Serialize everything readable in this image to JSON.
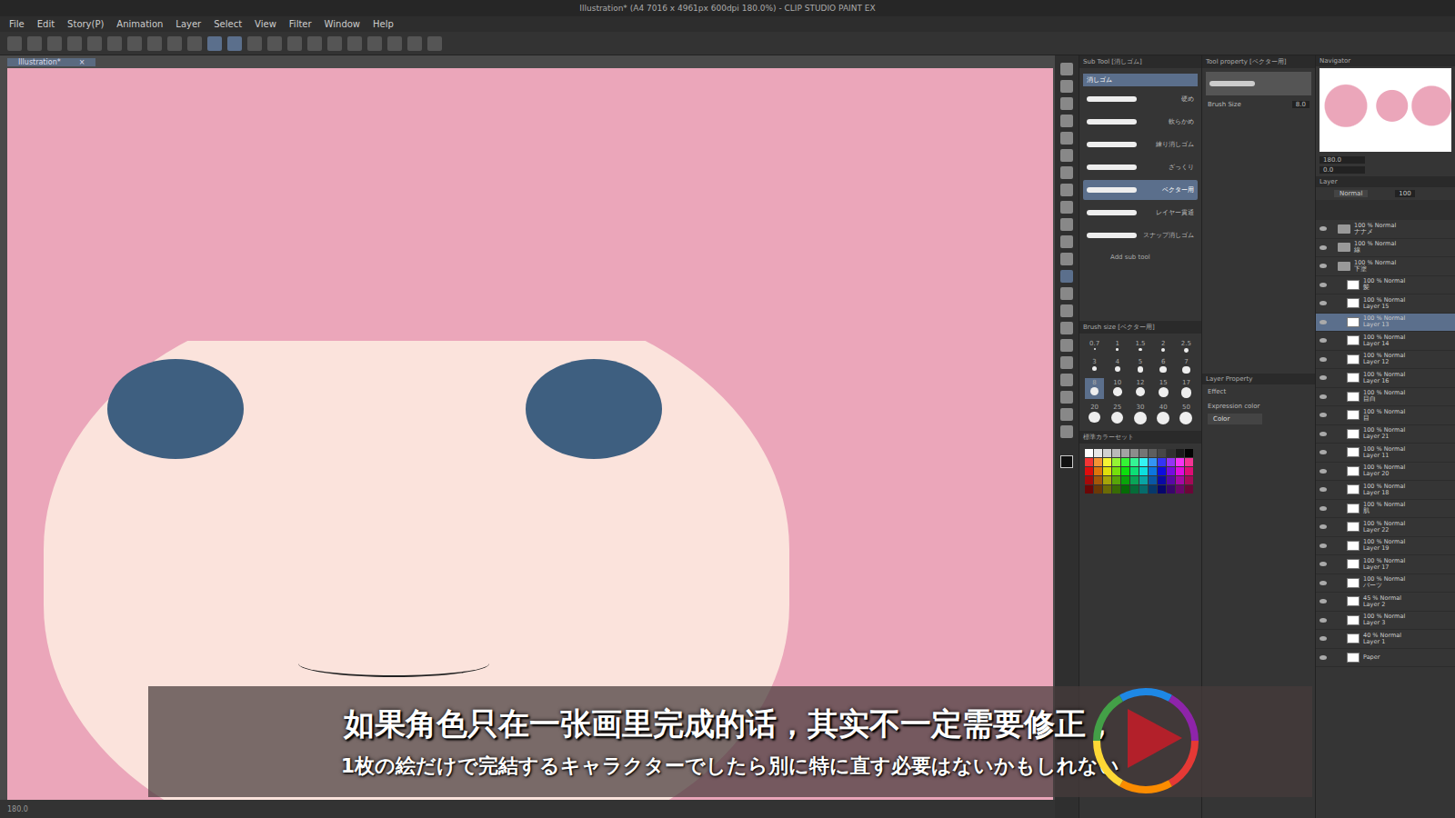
{
  "window": {
    "title": "Illustration* (A4 7016 x 4961px 600dpi 180.0%) - CLIP STUDIO PAINT EX"
  },
  "menu": [
    "File",
    "Edit",
    "Story(P)",
    "Animation",
    "Layer",
    "Select",
    "View",
    "Filter",
    "Window",
    "Help"
  ],
  "canvas_tab": {
    "label": "Illustration*",
    "close": "×"
  },
  "sub_tool": {
    "title": "Sub Tool [消しゴム]",
    "group": "消しゴム",
    "items": [
      {
        "label": "硬め",
        "selected": false
      },
      {
        "label": "軟らかめ",
        "selected": false
      },
      {
        "label": "練り消しゴム",
        "selected": false
      },
      {
        "label": "ざっくり",
        "selected": false
      },
      {
        "label": "ベクター用",
        "selected": true
      },
      {
        "label": "レイヤー貫通",
        "selected": false
      },
      {
        "label": "スナップ消しゴム",
        "selected": false
      }
    ],
    "add": "Add sub tool"
  },
  "tool_property": {
    "title": "Tool property [ベクター用]",
    "brush_size_label": "Brush Size",
    "brush_size": "8.0"
  },
  "brush_size_panel": {
    "title": "Brush size [ベクター用]",
    "sizes": [
      {
        "value": "0.7",
        "selected": false
      },
      {
        "value": "1",
        "selected": false
      },
      {
        "value": "1.5",
        "selected": false
      },
      {
        "value": "2",
        "selected": false
      },
      {
        "value": "2.5",
        "selected": false
      },
      {
        "value": "3",
        "selected": false
      },
      {
        "value": "4",
        "selected": false
      },
      {
        "value": "5",
        "selected": false
      },
      {
        "value": "6",
        "selected": false
      },
      {
        "value": "7",
        "selected": false
      },
      {
        "value": "8",
        "selected": true
      },
      {
        "value": "10",
        "selected": false
      },
      {
        "value": "12",
        "selected": false
      },
      {
        "value": "15",
        "selected": false
      },
      {
        "value": "17",
        "selected": false
      },
      {
        "value": "20",
        "selected": false
      },
      {
        "value": "25",
        "selected": false
      },
      {
        "value": "30",
        "selected": false
      },
      {
        "value": "40",
        "selected": false
      },
      {
        "value": "50",
        "selected": false
      }
    ]
  },
  "color_set": {
    "title": "標準カラーセット"
  },
  "navigator": {
    "title": "Navigator",
    "zoom": "180.0",
    "angle": "0.0"
  },
  "layer_property": {
    "title": "Layer Property",
    "effect": "Effect",
    "expression_label": "Expression color",
    "expression": "Color"
  },
  "layer": {
    "title": "Layer",
    "blend": "Normal",
    "opacity": "100",
    "layers": [
      {
        "mode": "100 % Normal",
        "name": "ナナメ",
        "kind": "folder",
        "selected": false
      },
      {
        "mode": "100 % Normal",
        "name": "線",
        "kind": "folder",
        "selected": false
      },
      {
        "mode": "100 % Normal",
        "name": "下塗",
        "kind": "folder",
        "selected": false
      },
      {
        "mode": "100 % Normal",
        "name": "髪",
        "kind": "layer",
        "selected": false
      },
      {
        "mode": "100 % Normal",
        "name": "Layer 15",
        "kind": "layer",
        "selected": false
      },
      {
        "mode": "100 % Normal",
        "name": "Layer 13",
        "kind": "layer",
        "selected": true
      },
      {
        "mode": "100 % Normal",
        "name": "Layer 14",
        "kind": "layer",
        "selected": false
      },
      {
        "mode": "100 % Normal",
        "name": "Layer 12",
        "kind": "layer",
        "selected": false
      },
      {
        "mode": "100 % Normal",
        "name": "Layer 16",
        "kind": "layer",
        "selected": false
      },
      {
        "mode": "100 % Normal",
        "name": "目白",
        "kind": "layer",
        "selected": false
      },
      {
        "mode": "100 % Normal",
        "name": "目",
        "kind": "layer",
        "selected": false
      },
      {
        "mode": "100 % Normal",
        "name": "Layer 21",
        "kind": "layer",
        "selected": false
      },
      {
        "mode": "100 % Normal",
        "name": "Layer 11",
        "kind": "layer",
        "selected": false
      },
      {
        "mode": "100 % Normal",
        "name": "Layer 20",
        "kind": "layer",
        "selected": false
      },
      {
        "mode": "100 % Normal",
        "name": "Layer 18",
        "kind": "layer",
        "selected": false
      },
      {
        "mode": "100 % Normal",
        "name": "肌",
        "kind": "layer",
        "selected": false
      },
      {
        "mode": "100 % Normal",
        "name": "Layer 22",
        "kind": "layer",
        "selected": false
      },
      {
        "mode": "100 % Normal",
        "name": "Layer 19",
        "kind": "layer",
        "selected": false
      },
      {
        "mode": "100 % Normal",
        "name": "Layer 17",
        "kind": "layer",
        "selected": false
      },
      {
        "mode": "100 % Normal",
        "name": "パーツ",
        "kind": "layer",
        "selected": false
      },
      {
        "mode": "45 % Normal",
        "name": "Layer 2",
        "kind": "layer",
        "selected": false
      },
      {
        "mode": "100 % Normal",
        "name": "Layer 3",
        "kind": "layer",
        "selected": false
      },
      {
        "mode": "40 % Normal",
        "name": "Layer 1",
        "kind": "layer",
        "selected": false
      },
      {
        "mode": "",
        "name": "Paper",
        "kind": "paper",
        "selected": false
      }
    ]
  },
  "subtitles": {
    "zh": "如果角色只在一张画里完成的话，其实不一定需要修正，",
    "ja": "1枚の絵だけで完結するキャラクターでしたら別に特に直す必要はないかもしれない"
  },
  "status": {
    "zoom": "180.0"
  }
}
